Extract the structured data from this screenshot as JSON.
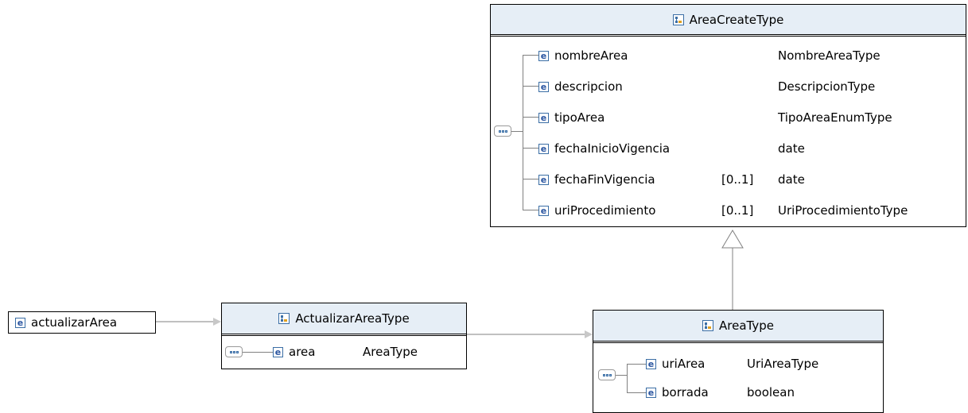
{
  "area_create_type": {
    "title": "AreaCreateType",
    "rows": [
      {
        "name": "nombreArea",
        "card": "",
        "type": "NombreAreaType"
      },
      {
        "name": "descripcion",
        "card": "",
        "type": "DescripcionType"
      },
      {
        "name": "tipoArea",
        "card": "",
        "type": "TipoAreaEnumType"
      },
      {
        "name": "fechaInicioVigencia",
        "card": "",
        "type": "date"
      },
      {
        "name": "fechaFinVigencia",
        "card": "[0..1]",
        "type": "date"
      },
      {
        "name": "uriProcedimiento",
        "card": "[0..1]",
        "type": "UriProcedimientoType"
      }
    ]
  },
  "root_element": {
    "name": "actualizarArea"
  },
  "actualizar_area_type": {
    "title": "ActualizarAreaType",
    "rows": [
      {
        "name": "area",
        "type": "AreaType"
      }
    ]
  },
  "area_type": {
    "title": "AreaType",
    "rows": [
      {
        "name": "uriArea",
        "type": "UriAreaType"
      },
      {
        "name": "borrada",
        "type": "boolean"
      }
    ]
  },
  "icons": {
    "element": "e",
    "complex_type": "complex-type-icon",
    "sequence": "sequence-compositor-icon"
  },
  "colors": {
    "header_bg": "#e6eef6",
    "icon_blue": "#3b6ea5",
    "connector": "#808080"
  }
}
